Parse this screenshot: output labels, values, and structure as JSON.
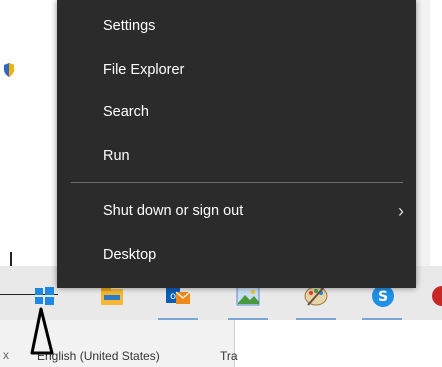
{
  "menu": {
    "items": [
      {
        "label": "Settings"
      },
      {
        "label": "File Explorer"
      },
      {
        "label": "Search"
      },
      {
        "label": "Run"
      },
      {
        "label": "Shut down or sign out",
        "has_submenu": true
      },
      {
        "label": "Desktop"
      }
    ],
    "submenu_chevron": "›"
  },
  "taskbar": {
    "icons": [
      {
        "name": "windows-start-icon"
      },
      {
        "name": "file-explorer-icon"
      },
      {
        "name": "outlook-icon"
      },
      {
        "name": "photos-icon"
      },
      {
        "name": "paint-icon"
      },
      {
        "name": "skype-icon"
      },
      {
        "name": "partial-app-icon"
      }
    ]
  },
  "status": {
    "language": "English (United States)",
    "truncated": "Tra",
    "close_glyph": "x"
  },
  "colors": {
    "menu_bg": "#2b2b2b",
    "taskbar_bg": "#e9e9e9",
    "accent": "#0078d7"
  }
}
